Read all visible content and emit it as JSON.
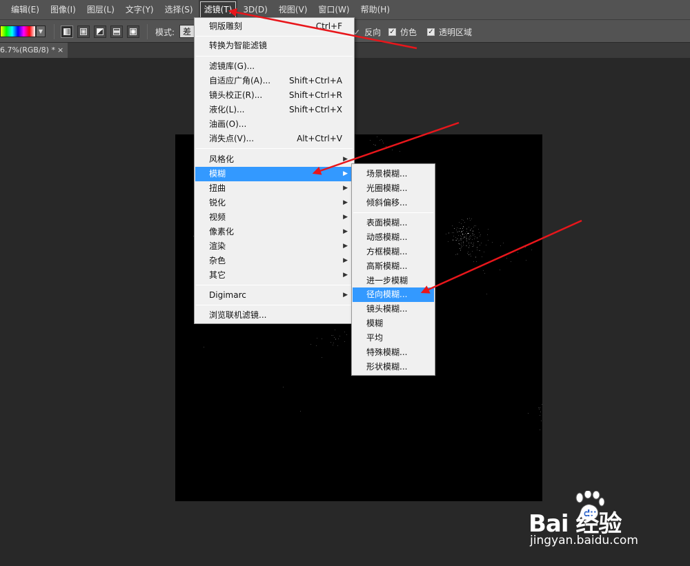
{
  "menubar": {
    "items": [
      "编辑(E)",
      "图像(I)",
      "图层(L)",
      "文字(Y)",
      "选择(S)",
      "滤镜(T)",
      "3D(D)",
      "视图(V)",
      "窗口(W)",
      "帮助(H)"
    ],
    "active_index": 5
  },
  "options": {
    "mode_label": "模式:",
    "mode_value": "差",
    "checkboxes": [
      {
        "label": "反向",
        "checked": true
      },
      {
        "label": "仿色",
        "checked": true
      },
      {
        "label": "透明区域",
        "checked": true
      }
    ]
  },
  "document": {
    "tab_title": "6.7%(RGB/8) *",
    "close_glyph": "×"
  },
  "filter_menu": {
    "items": [
      {
        "label": "铜版雕刻",
        "shortcut": "Ctrl+F"
      },
      {
        "label": "转换为智能滤镜",
        "shortcut": ""
      },
      {
        "label": "滤镜库(G)...",
        "shortcut": ""
      },
      {
        "label": "自适应广角(A)...",
        "shortcut": "Shift+Ctrl+A"
      },
      {
        "label": "镜头校正(R)...",
        "shortcut": "Shift+Ctrl+R"
      },
      {
        "label": "液化(L)...",
        "shortcut": "Shift+Ctrl+X"
      },
      {
        "label": "油画(O)...",
        "shortcut": ""
      },
      {
        "label": "消失点(V)...",
        "shortcut": "Alt+Ctrl+V"
      },
      {
        "label": "风格化",
        "shortcut": ""
      },
      {
        "label": "模糊",
        "shortcut": ""
      },
      {
        "label": "扭曲",
        "shortcut": ""
      },
      {
        "label": "锐化",
        "shortcut": ""
      },
      {
        "label": "视频",
        "shortcut": ""
      },
      {
        "label": "像素化",
        "shortcut": ""
      },
      {
        "label": "渲染",
        "shortcut": ""
      },
      {
        "label": "杂色",
        "shortcut": ""
      },
      {
        "label": "其它",
        "shortcut": ""
      },
      {
        "label": "Digimarc",
        "shortcut": ""
      },
      {
        "label": "浏览联机滤镜...",
        "shortcut": ""
      }
    ],
    "highlighted": "模糊"
  },
  "blur_submenu": {
    "items": [
      "场景模糊...",
      "光圈模糊...",
      "倾斜偏移...",
      "表面模糊...",
      "动感模糊...",
      "方框模糊...",
      "高斯模糊...",
      "进一步模糊",
      "径向模糊...",
      "镜头模糊...",
      "模糊",
      "平均",
      "特殊模糊...",
      "形状模糊..."
    ],
    "highlighted": "径向模糊..."
  },
  "watermark": {
    "brand": "Bai 经验",
    "url": "jingyan.baidu.com"
  },
  "colors": {
    "menu_highlight": "#3399ff",
    "arrow": "#e8161b",
    "menubar_bg": "#535353",
    "workspace_bg": "#282828"
  }
}
